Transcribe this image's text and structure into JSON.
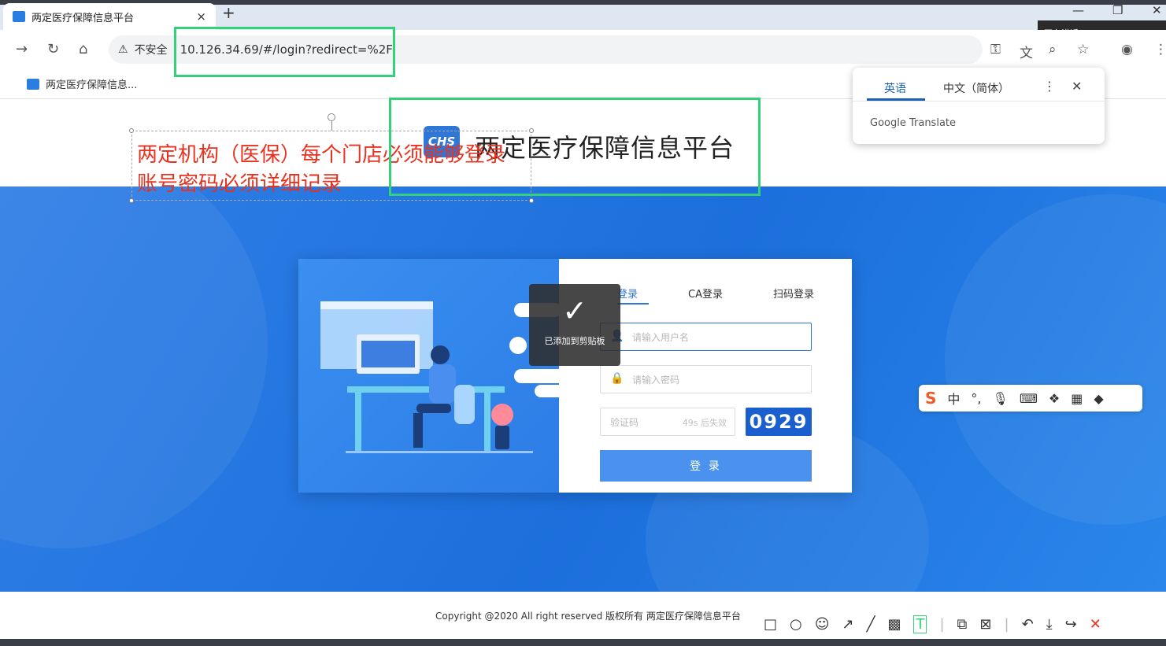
{
  "browser": {
    "tab_title": "两定医疗保障信息平台",
    "tab_close": "×",
    "new_tab": "+",
    "security_label": "不安全",
    "url": "10.126.34.69/#/login?redirect=%2F",
    "bookmark_label": "两定医疗保障信息...",
    "speaking_label": "正在讲话:"
  },
  "page": {
    "logo_text": "CHS",
    "site_title": "两定医疗保障信息平台",
    "footer": "Copyright @2020 All right reserved 版权所有 两定医疗保障信息平台"
  },
  "annotation": {
    "line1": "两定机构（医保）每个门店必须能够登录",
    "line2": "账号密码必须详细记录"
  },
  "login": {
    "tabs": [
      "登录",
      "CA登录",
      "扫码登录"
    ],
    "username_placeholder": "请输入用户名",
    "password_placeholder": "请输入密码",
    "captcha_placeholder": "验证码",
    "captcha_timer": "49s 后失效",
    "captcha_code": "0929",
    "submit_label": "登 录"
  },
  "toast": {
    "message": "已添加到剪贴板"
  },
  "translate_popup": {
    "lang_source": "英语",
    "lang_target": "中文（简体）",
    "brand": "Google Translate"
  },
  "ime": {
    "mode": "中"
  },
  "colors": {
    "accent_blue": "#2f77d7",
    "annotation_red": "#e8321f",
    "highlight_green": "#35d17a"
  }
}
